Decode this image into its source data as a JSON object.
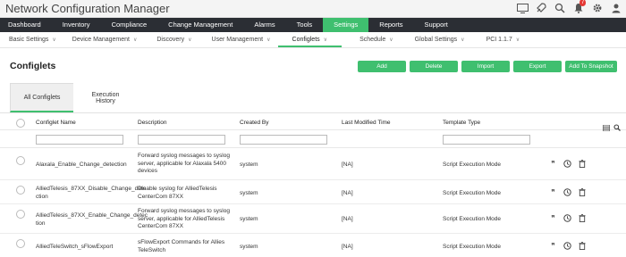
{
  "app": {
    "title": "Network Configuration Manager",
    "notification_count": "7"
  },
  "main_nav": [
    "Dashboard",
    "Inventory",
    "Compliance",
    "Change Management",
    "Alarms",
    "Tools",
    "Settings",
    "Reports",
    "Support"
  ],
  "main_nav_active": "Settings",
  "sub_nav": [
    "Basic Settings",
    "Device Management",
    "Discovery",
    "User Management",
    "Configlets",
    "Schedule",
    "Global Settings",
    "PCI 1.1.7"
  ],
  "sub_nav_active": "Configlets",
  "page": {
    "title": "Configlets",
    "buttons": [
      "Add",
      "Delete",
      "Import",
      "Export",
      "Add To Snapshot"
    ]
  },
  "tabs": [
    "All Configlets",
    "Execution History"
  ],
  "table": {
    "headers": [
      "Configlet Name",
      "Description",
      "Created By",
      "Last Modified Time",
      "Template Type"
    ],
    "rows": [
      {
        "name": "Alaxala_Enable_Change_detection",
        "description_lines": [
          "Forward syslog messages to syslog",
          "server, applicable for Alaxala 5400",
          "devices"
        ],
        "created_by": "system",
        "last_modified": "[NA]",
        "template_type": "Script Execution Mode"
      },
      {
        "name_lines": [
          "AlliedTelesis_87XX_Disable_Change_dete",
          "ction"
        ],
        "description_lines": [
          "Disable syslog for AlliedTelesis",
          "CenterCom 87XX"
        ],
        "created_by": "system",
        "last_modified": "[NA]",
        "template_type": "Script Execution Mode"
      },
      {
        "name_lines": [
          "AlliedTelesis_87XX_Enable_Change_detec",
          "tion"
        ],
        "description_lines": [
          "Forward syslog messages to syslog",
          "server, applicable for AlliedTelesis",
          "CenterCom 87XX"
        ],
        "created_by": "system",
        "last_modified": "[NA]",
        "template_type": "Script Execution Mode"
      },
      {
        "name": "AlliedTeleSwitch_sFlowExport",
        "description_lines": [
          "sFlowExport Commands for Allies",
          "TeleSwitch"
        ],
        "created_by": "system",
        "last_modified": "[NA]",
        "template_type": "Script Execution Mode"
      }
    ]
  },
  "colors": {
    "accent": "#3fbf6f",
    "nav_bg": "#2b2e34"
  },
  "icons": [
    "monitor-icon",
    "rocket-icon",
    "search-icon",
    "bell-icon",
    "gear-icon",
    "user-icon",
    "column-chooser-icon",
    "table-search-icon",
    "quote-icon",
    "clock-icon",
    "trash-icon"
  ]
}
